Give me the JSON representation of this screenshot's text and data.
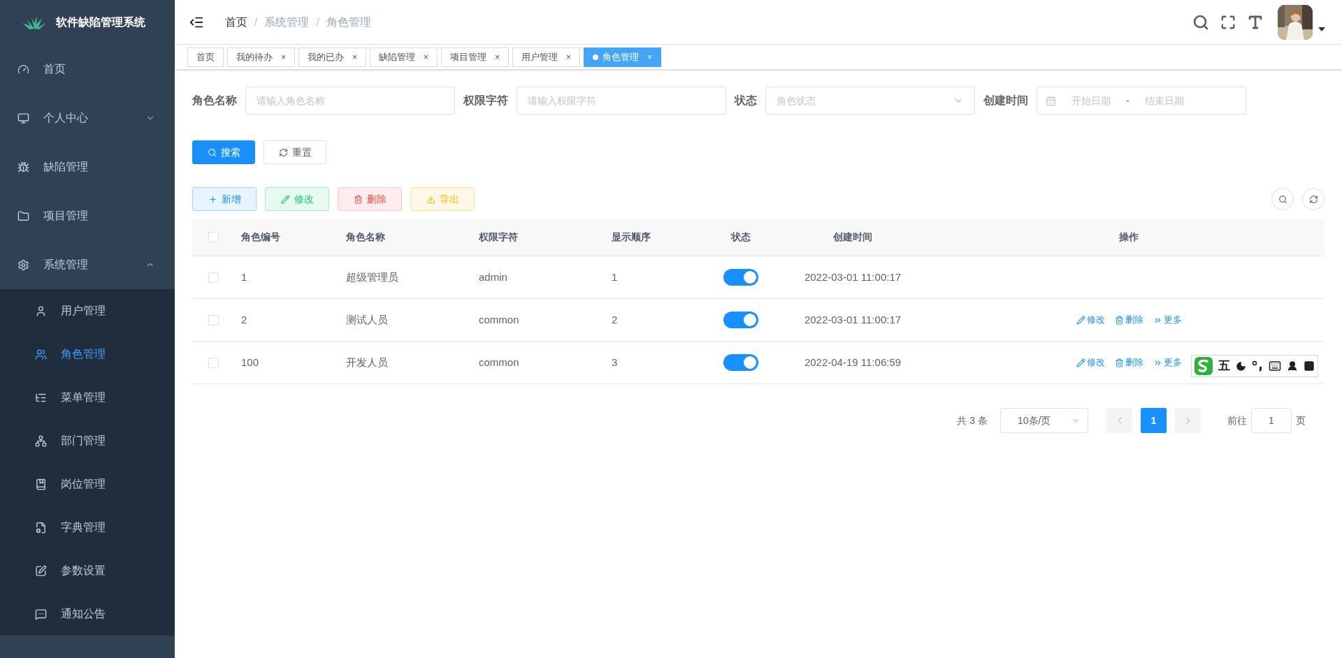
{
  "sidebar": {
    "title": "软件缺陷管理系统",
    "items": [
      {
        "label": "首页",
        "selected": false
      },
      {
        "label": "个人中心",
        "expanded": false,
        "selected": false
      },
      {
        "label": "缺陷管理",
        "selected": false
      },
      {
        "label": "项目管理",
        "selected": false
      },
      {
        "label": "系统管理",
        "expanded": true,
        "selected": false,
        "children": [
          {
            "label": "用户管理",
            "selected": false
          },
          {
            "label": "角色管理",
            "selected": true
          },
          {
            "label": "菜单管理",
            "selected": false
          },
          {
            "label": "部门管理",
            "selected": false
          },
          {
            "label": "岗位管理",
            "selected": false
          },
          {
            "label": "字典管理",
            "selected": false
          },
          {
            "label": "参数设置",
            "selected": false
          },
          {
            "label": "通知公告",
            "selected": false
          }
        ]
      }
    ]
  },
  "breadcrumb": [
    "首页",
    "系统管理",
    "角色管理"
  ],
  "breadcrumb_separator": "/",
  "tabs": [
    {
      "label": "首页",
      "closable": false,
      "selected": false
    },
    {
      "label": "我的待办",
      "closable": true,
      "selected": false
    },
    {
      "label": "我的已办",
      "closable": true,
      "selected": false
    },
    {
      "label": "缺陷管理",
      "closable": true,
      "selected": false
    },
    {
      "label": "项目管理",
      "closable": true,
      "selected": false
    },
    {
      "label": "用户管理",
      "closable": true,
      "selected": false
    },
    {
      "label": "角色管理",
      "closable": true,
      "selected": true
    }
  ],
  "close_glyph": "×",
  "filters": [
    {
      "label": "角色名称",
      "kind": "input",
      "placeholder": "请输入角色名称"
    },
    {
      "label": "权限字符",
      "kind": "input",
      "placeholder": "请输入权限字符"
    },
    {
      "label": "状态",
      "kind": "select",
      "placeholder": "角色状态"
    },
    {
      "label": "创建时间",
      "kind": "daterange",
      "placeholder": "开始日期",
      "placeholder_end": "结束日期",
      "separator": "-"
    }
  ],
  "search_buttons": [
    {
      "label": "搜索",
      "kind": "primary"
    },
    {
      "label": "重置",
      "kind": "default"
    }
  ],
  "toolbar": [
    {
      "label": "新增",
      "kind": "add"
    },
    {
      "label": "修改",
      "kind": "edit"
    },
    {
      "label": "删除",
      "kind": "delete"
    },
    {
      "label": "导出",
      "kind": "export"
    }
  ],
  "table": {
    "all_checked": false,
    "columns": [
      "角色编号",
      "角色名称",
      "权限字符",
      "显示顺序",
      "状态",
      "创建时间",
      "操作"
    ],
    "rows": [
      {
        "checked": false,
        "id": "1",
        "name": "超级管理员",
        "key": "admin",
        "order": "1",
        "on": true,
        "created": "2022-03-01 11:00:17"
      },
      {
        "checked": false,
        "id": "2",
        "name": "测试人员",
        "key": "common",
        "order": "2",
        "on": true,
        "created": "2022-03-01 11:00:17",
        "actions": [
          {
            "label": "修改",
            "kind": "edit"
          },
          {
            "label": "删除",
            "kind": "delete"
          },
          {
            "label": "更多",
            "kind": "more"
          }
        ]
      },
      {
        "checked": false,
        "id": "100",
        "name": "开发人员",
        "key": "common",
        "order": "3",
        "on": true,
        "created": "2022-04-19 11:06:59",
        "actions": [
          {
            "label": "修改",
            "kind": "edit"
          },
          {
            "label": "删除",
            "kind": "delete"
          },
          {
            "label": "更多",
            "kind": "more"
          }
        ]
      }
    ]
  },
  "pagination": {
    "total": "共 3 条",
    "page_size": "10条/页",
    "pages": [
      {
        "label": "1",
        "selected": true
      }
    ],
    "goto_label": "前往",
    "goto_value": "1",
    "goto_suffix": "页"
  },
  "ime_toolbar": {
    "mode": "五"
  }
}
